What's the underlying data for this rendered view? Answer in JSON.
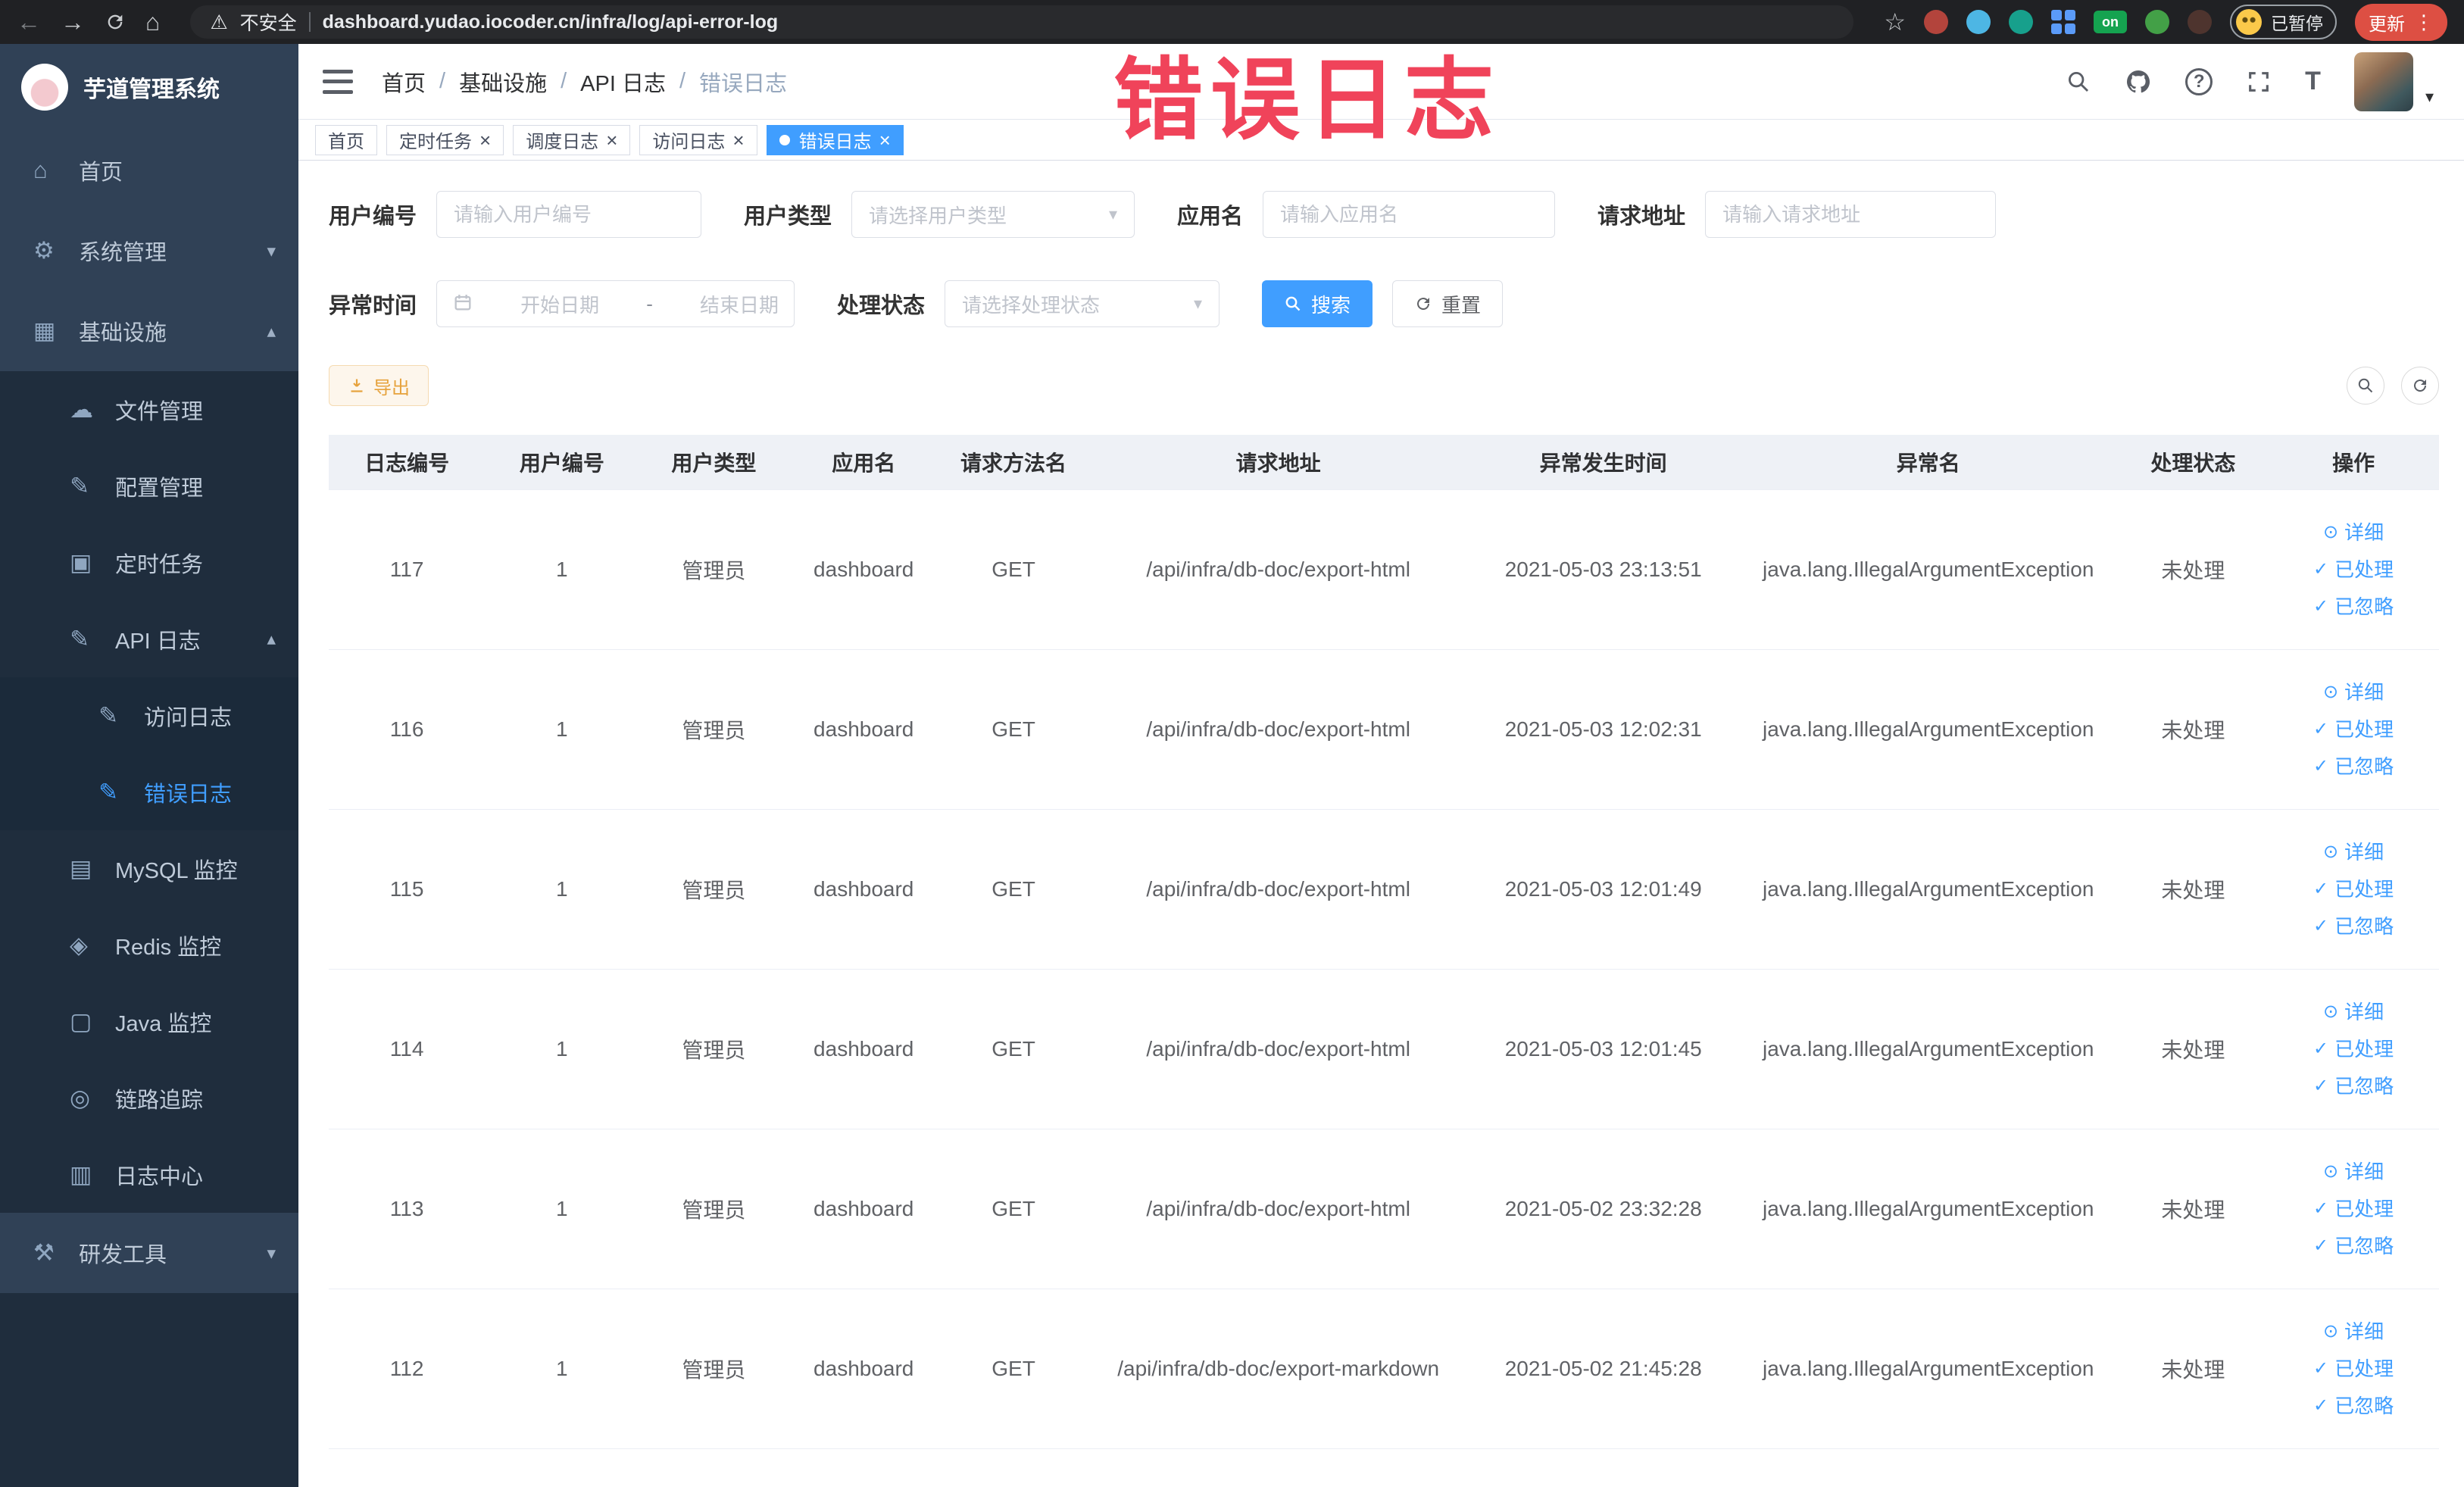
{
  "browser": {
    "security_label": "不安全",
    "url": "dashboard.yudao.iocoder.cn/infra/log/api-error-log",
    "profile_badge": "已暂停",
    "update_button": "更新",
    "extension_on_label": "on"
  },
  "sidebar": {
    "logo_title": "芋道管理系统",
    "items": [
      {
        "label": "首页",
        "glyph": "⌂",
        "arrow": "",
        "cls": "lvl0"
      },
      {
        "label": "系统管理",
        "glyph": "⚙",
        "arrow": "▾",
        "cls": "lvl0"
      },
      {
        "label": "基础设施",
        "glyph": "▦",
        "arrow": "▴",
        "cls": "lvl0"
      },
      {
        "label": "文件管理",
        "glyph": "☁",
        "arrow": "",
        "cls": "lvl1"
      },
      {
        "label": "配置管理",
        "glyph": "✎",
        "arrow": "",
        "cls": "lvl1"
      },
      {
        "label": "定时任务",
        "glyph": "▣",
        "arrow": "",
        "cls": "lvl1"
      },
      {
        "label": "API 日志",
        "glyph": "✎",
        "arrow": "▴",
        "cls": "lvl1"
      },
      {
        "label": "访问日志",
        "glyph": "✎",
        "arrow": "",
        "cls": "lvl2"
      },
      {
        "label": "错误日志",
        "glyph": "✎",
        "arrow": "",
        "cls": "lvl2 active"
      },
      {
        "label": "MySQL 监控",
        "glyph": "▤",
        "arrow": "",
        "cls": "lvl1"
      },
      {
        "label": "Redis 监控",
        "glyph": "◈",
        "arrow": "",
        "cls": "lvl1"
      },
      {
        "label": "Java 监控",
        "glyph": "▢",
        "arrow": "",
        "cls": "lvl1"
      },
      {
        "label": "链路追踪",
        "glyph": "◎",
        "arrow": "",
        "cls": "lvl1"
      },
      {
        "label": "日志中心",
        "glyph": "▥",
        "arrow": "",
        "cls": "lvl1"
      },
      {
        "label": "研发工具",
        "glyph": "⚒",
        "arrow": "▾",
        "cls": "lvl0"
      }
    ]
  },
  "topbar": {
    "breadcrumb": [
      "首页",
      "基础设施",
      "API 日志",
      "错误日志"
    ],
    "separator": "/"
  },
  "tabs": [
    {
      "label": "首页"
    },
    {
      "label": "定时任务"
    },
    {
      "label": "调度日志"
    },
    {
      "label": "访问日志"
    },
    {
      "label": "错误日志"
    }
  ],
  "icons": {
    "close": "×",
    "caret": "▾",
    "eye": "⊙",
    "check": "✓",
    "warning": "⚠",
    "back": "←",
    "forward": "→",
    "home": "⌂",
    "star": "☆",
    "dots": "⋮",
    "help": "?",
    "text_size": "T"
  },
  "annotation": {
    "text": "错误日志"
  },
  "filters": {
    "fields": [
      {
        "label": "用户编号",
        "placeholder": "请输入用户编号"
      },
      {
        "label": "用户类型",
        "placeholder": "请选择用户类型"
      },
      {
        "label": "应用名",
        "placeholder": "请输入应用名"
      },
      {
        "label": "请求地址",
        "placeholder": "请输入请求地址"
      }
    ],
    "time_label": "异常时间",
    "date_start": "开始日期",
    "date_sep": "-",
    "date_end": "结束日期",
    "status_label": "处理状态",
    "status_placeholder": "请选择处理状态",
    "search_button": "搜索",
    "reset_button": "重置",
    "export_button": "导出"
  },
  "table": {
    "columns": [
      "日志编号",
      "用户编号",
      "用户类型",
      "应用名",
      "请求方法名",
      "请求地址",
      "异常发生时间",
      "异常名",
      "处理状态",
      "操作"
    ],
    "actions": {
      "detail": "详细",
      "done": "已处理",
      "ignore": "已忽略"
    },
    "rows": [
      {
        "cells": [
          "117",
          "1",
          "管理员",
          "dashboard",
          "GET",
          "/api/infra/db-doc/export-html",
          "2021-05-03 23:13:51",
          "java.lang.IllegalArgumentException",
          "未处理"
        ]
      },
      {
        "cells": [
          "116",
          "1",
          "管理员",
          "dashboard",
          "GET",
          "/api/infra/db-doc/export-html",
          "2021-05-03 12:02:31",
          "java.lang.IllegalArgumentException",
          "未处理"
        ]
      },
      {
        "cells": [
          "115",
          "1",
          "管理员",
          "dashboard",
          "GET",
          "/api/infra/db-doc/export-html",
          "2021-05-03 12:01:49",
          "java.lang.IllegalArgumentException",
          "未处理"
        ]
      },
      {
        "cells": [
          "114",
          "1",
          "管理员",
          "dashboard",
          "GET",
          "/api/infra/db-doc/export-html",
          "2021-05-03 12:01:45",
          "java.lang.IllegalArgumentException",
          "未处理"
        ]
      },
      {
        "cells": [
          "113",
          "1",
          "管理员",
          "dashboard",
          "GET",
          "/api/infra/db-doc/export-html",
          "2021-05-02 23:32:28",
          "java.lang.IllegalArgumentException",
          "未处理"
        ]
      },
      {
        "cells": [
          "112",
          "1",
          "管理员",
          "dashboard",
          "GET",
          "/api/infra/db-doc/export-markdown",
          "2021-05-02 21:45:28",
          "java.lang.IllegalArgumentException",
          "未处理"
        ]
      }
    ]
  },
  "colors": {
    "accent": "#409eff",
    "annotation_red": "#f0435a",
    "export_warning": "#e6a23c",
    "sidebar_bg": "#304156",
    "sidebar_sub_bg": "#1f2d3d"
  }
}
